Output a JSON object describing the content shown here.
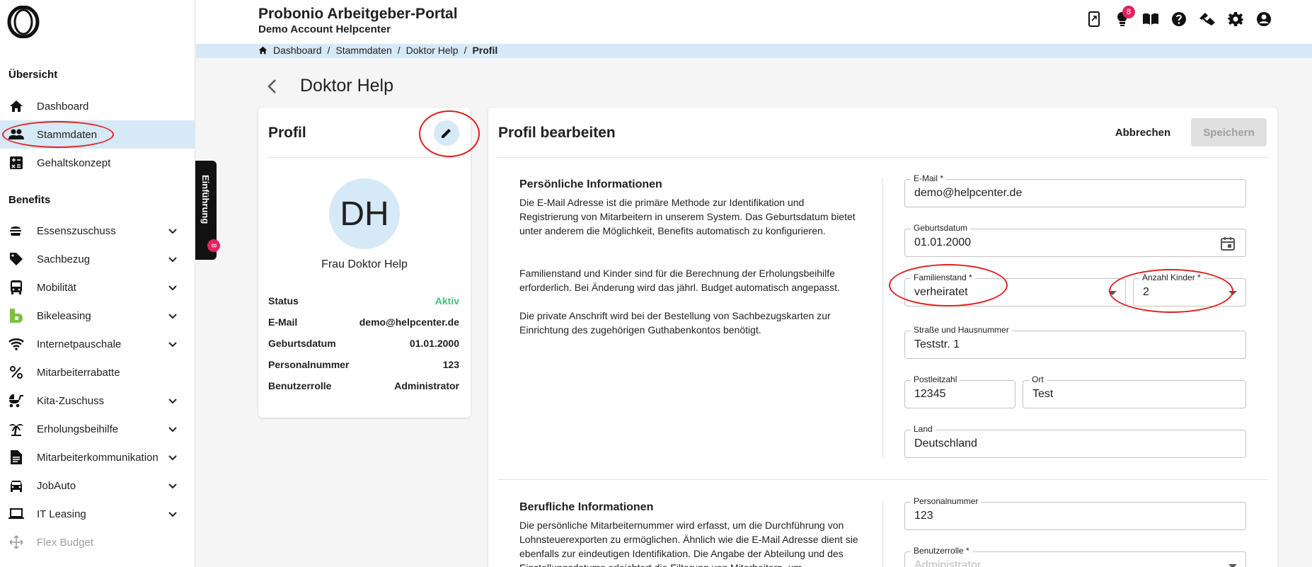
{
  "header": {
    "title": "Probonio Arbeitgeber-Portal",
    "subtitle": "Demo Account Helpcenter",
    "notification_count": "8"
  },
  "breadcrumb": {
    "items": [
      "Dashboard",
      "Stammdaten",
      "Doktor Help"
    ],
    "current": "Profil",
    "sep": "/"
  },
  "sidebar": {
    "section_overview": "Übersicht",
    "section_benefits": "Benefits",
    "overview_items": [
      {
        "label": "Dashboard",
        "icon": "home-icon"
      },
      {
        "label": "Stammdaten",
        "icon": "people-icon"
      },
      {
        "label": "Gehaltskonzept",
        "icon": "calculator-icon"
      }
    ],
    "benefit_items": [
      {
        "label": "Essenszuschuss",
        "icon": "fastfood-icon"
      },
      {
        "label": "Sachbezug",
        "icon": "tag-icon"
      },
      {
        "label": "Mobilität",
        "icon": "bus-icon"
      },
      {
        "label": "Bikeleasing",
        "icon": "bikeleasing-icon"
      },
      {
        "label": "Internetpauschale",
        "icon": "wifi-icon"
      },
      {
        "label": "Mitarbeiterrabatte",
        "icon": "percent-icon"
      },
      {
        "label": "Kita-Zuschuss",
        "icon": "stroller-icon"
      },
      {
        "label": "Erholungsbeihilfe",
        "icon": "palm-tree-icon"
      },
      {
        "label": "Mitarbeiterkommunikation",
        "icon": "document-icon"
      },
      {
        "label": "JobAuto",
        "icon": "car-icon"
      },
      {
        "label": "IT Leasing",
        "icon": "laptop-icon"
      },
      {
        "label": "Flex Budget",
        "icon": "move-icon"
      }
    ],
    "intro_tab": "Einführung",
    "intro_badge": "8"
  },
  "page": {
    "title": "Doktor Help"
  },
  "profile": {
    "card_title": "Profil",
    "initials": "DH",
    "name": "Frau Doktor Help",
    "rows": [
      {
        "key": "Status",
        "value": "Aktiv"
      },
      {
        "key": "E-Mail",
        "value": "demo@helpcenter.de"
      },
      {
        "key": "Geburtsdatum",
        "value": "01.01.2000"
      },
      {
        "key": "Personalnummer",
        "value": "123"
      },
      {
        "key": "Benutzerrolle",
        "value": "Administrator"
      }
    ],
    "status_color": "#3cc37a"
  },
  "edit": {
    "title": "Profil bearbeiten",
    "cancel": "Abbrechen",
    "save": "Speichern",
    "personal": {
      "heading": "Persönliche Informationen",
      "p1": "Die E-Mail Adresse ist die primäre Methode zur Identifikation und Registrierung von Mitarbeitern in unserem System. Das Geburtsdatum bietet unter anderem die Möglichkeit, Benefits automatisch zu konfigurieren.",
      "p2": "Familienstand und Kinder sind für die Berechnung der Erholungsbeihilfe erforderlich. Bei Änderung wird das jährl. Budget automatisch angepasst.",
      "p3": "Die private Anschrift wird bei der Bestellung von Sachbezugskarten zur Einrichtung des zugehörigen Guthabenkontos benötigt."
    },
    "fields": {
      "email": {
        "label": "E-Mail *",
        "value": "demo@helpcenter.de"
      },
      "birthdate": {
        "label": "Geburtsdatum",
        "value": "01.01.2000"
      },
      "marital": {
        "label": "Familienstand *",
        "value": "verheiratet"
      },
      "children": {
        "label": "Anzahl Kinder *",
        "value": "2"
      },
      "street": {
        "label": "Straße und Hausnummer",
        "value": "Teststr. 1"
      },
      "zip": {
        "label": "Postleitzahl",
        "value": "12345"
      },
      "city": {
        "label": "Ort",
        "value": "Test"
      },
      "country": {
        "label": "Land",
        "value": "Deutschland"
      },
      "personnel": {
        "label": "Personalnummer",
        "value": "123"
      },
      "role": {
        "label": "Benutzerrolle *",
        "value": "Administrator"
      }
    },
    "professional": {
      "heading": "Berufliche Informationen",
      "p1": "Die persönliche Mitarbeiternummer wird erfasst, um die Durchführung von Lohnsteuerexporten zu ermöglichen. Ähnlich wie die E-Mail Adresse dient sie ebenfalls zur eindeutigen Identifikation. Die Angabe der Abteilung und des Einstellungsdatums erleichtert die Filterung von Mitarbeitern, um"
    }
  },
  "colors": {
    "accent_light": "#d6e9f6",
    "badge": "#e0245e",
    "annotation": "#e02020"
  }
}
